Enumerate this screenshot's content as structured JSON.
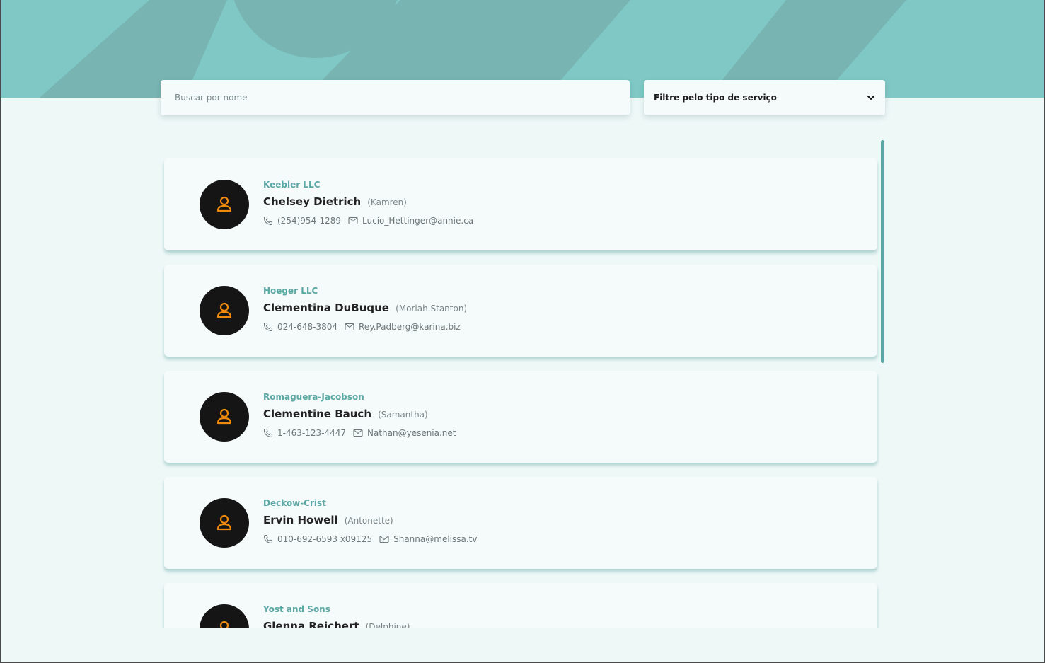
{
  "colors": {
    "hero_bg": "#7fc8c5",
    "hero_shape": "#78b4b2",
    "accent": "#5ba8a4",
    "avatar_bg": "#151515",
    "avatar_icon": "#f08a0c",
    "page_bg": "#eef8f7",
    "card_bg": "#f5fbfb"
  },
  "search": {
    "placeholder": "Buscar por nome"
  },
  "filter": {
    "label": "Filtre pelo tipo de serviço",
    "icon": "chevron-down-icon"
  },
  "contacts": [
    {
      "company": "Keebler LLC",
      "name": "Chelsey Dietrich",
      "username": "(Kamren)",
      "phone": "(254)954-1289",
      "email": "Lucio_Hettinger@annie.ca"
    },
    {
      "company": "Hoeger LLC",
      "name": "Clementina DuBuque",
      "username": "(Moriah.Stanton)",
      "phone": "024-648-3804",
      "email": "Rey.Padberg@karina.biz"
    },
    {
      "company": "Romaguera-Jacobson",
      "name": "Clementine Bauch",
      "username": "(Samantha)",
      "phone": "1-463-123-4447",
      "email": "Nathan@yesenia.net"
    },
    {
      "company": "Deckow-Crist",
      "name": "Ervin Howell",
      "username": "(Antonette)",
      "phone": "010-692-6593 x09125",
      "email": "Shanna@melissa.tv"
    },
    {
      "company": "Yost and Sons",
      "name": "Glenna Reichert",
      "username": "(Delphine)",
      "phone": "",
      "email": ""
    }
  ]
}
